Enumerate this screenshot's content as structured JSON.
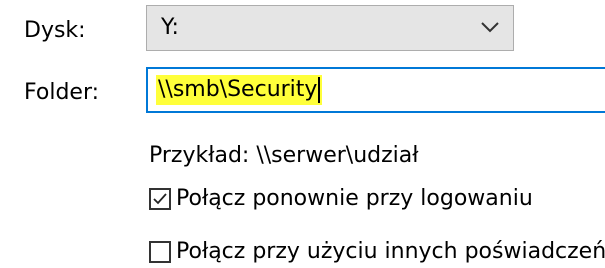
{
  "drive": {
    "label": "Dysk:",
    "value": "Y:",
    "dropdown_icon": "chevron-down-icon"
  },
  "folder": {
    "label": "Folder:",
    "value": "\\\\smb\\Security",
    "highlight_color": "#ffff3a",
    "focus_border_color": "#0078d7"
  },
  "example": {
    "text": "Przykład: \\\\serwer\\udział"
  },
  "reconnect": {
    "label": "Połącz ponownie przy logowaniu",
    "checked": true
  },
  "other_credentials": {
    "label": "Połącz przy użyciu innych poświadczeń",
    "checked": false
  }
}
